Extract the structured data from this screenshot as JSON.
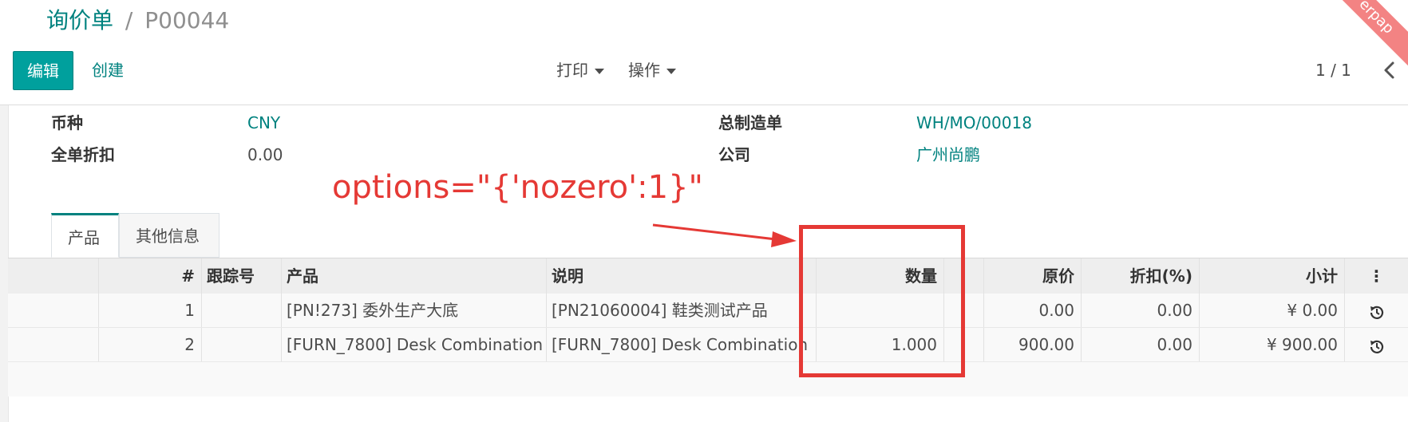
{
  "breadcrumb": {
    "root": "询价单",
    "separator": "/",
    "current": "P00044"
  },
  "buttons": {
    "edit": "编辑",
    "create": "创建"
  },
  "actions": {
    "print": "打印",
    "action": "操作"
  },
  "pager": {
    "value": "1 / 1"
  },
  "ribbon": {
    "text": "erpap"
  },
  "form": {
    "currency_label": "币种",
    "currency_value": "CNY",
    "discount_label": "全单折扣",
    "discount_value": "0.00",
    "mo_label": "总制造单",
    "mo_value": "WH/MO/00018",
    "company_label": "公司",
    "company_value": "广州尚鹏"
  },
  "annotation": {
    "text": "options=\"{'nozero':1}\""
  },
  "tabs": [
    {
      "label": "产品"
    },
    {
      "label": "其他信息"
    }
  ],
  "table": {
    "headers": {
      "no": "#",
      "tracking": "跟踪号",
      "product": "产品",
      "description": "说明",
      "qty": "数量",
      "price": "原价",
      "discount": "折扣(%)",
      "subtotal": "小计",
      "options": "⋮"
    },
    "rows": [
      {
        "no": "1",
        "tracking": "",
        "product": "[PN!273] 委外生产大底",
        "description": "[PN21060004] 鞋类测试产品",
        "qty": "",
        "price": "0.00",
        "discount": "0.00",
        "subtotal": "¥ 0.00"
      },
      {
        "no": "2",
        "tracking": "",
        "product": "[FURN_7800] Desk Combination",
        "description": "[FURN_7800] Desk Combination",
        "qty": "1.000",
        "price": "900.00",
        "discount": "0.00",
        "subtotal": "¥ 900.00"
      }
    ]
  },
  "icons": {
    "pager_prev": "chevron-left-icon",
    "row_action": "history-icon",
    "caret": "caret-down-icon"
  },
  "colors": {
    "accent": "#00a09d",
    "link": "#00827f",
    "annotation": "#e53935"
  }
}
